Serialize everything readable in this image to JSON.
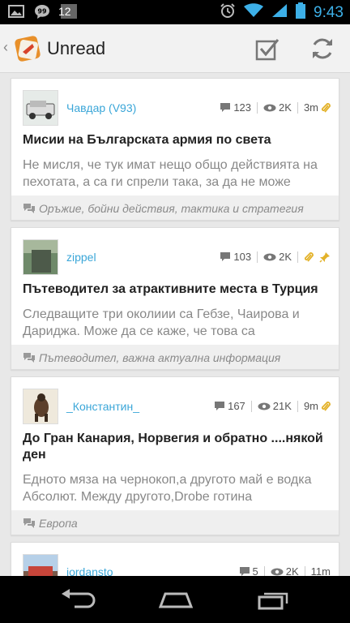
{
  "status_bar": {
    "time": "9:43",
    "notification_badge": "12",
    "icons": [
      "gallery-icon",
      "talk-icon",
      "notification-count-icon",
      "alarm-icon",
      "wifi-icon",
      "signal-icon",
      "battery-icon"
    ]
  },
  "action_bar": {
    "title": "Unread",
    "actions": [
      "mark-all-read-icon",
      "refresh-icon"
    ]
  },
  "topics": [
    {
      "author": "Чавдар (V93)",
      "replies": "123",
      "views": "2K",
      "time": "3m",
      "has_attachment": true,
      "pinned": false,
      "title": "Мисии на Българската армия по света",
      "preview": "Не мисля, че тук имат нещо общо действията на пехотата, а са ги спрели така, за да не може",
      "forum": "Оръжие, бойни действия, тактика и стратегия"
    },
    {
      "author": "zippel",
      "replies": "103",
      "views": "2K",
      "time": "",
      "has_attachment": true,
      "pinned": true,
      "title": "Пътеводител за атрактивните места в Турция",
      "preview": "Следващите три околиии са Гебзе, Чаирова и Дариджа. Може да се каже, че това са",
      "forum": "Пътеводител, важна актуална информация"
    },
    {
      "author": "_Константин_",
      "replies": "167",
      "views": "21K",
      "time": "9m",
      "has_attachment": true,
      "pinned": false,
      "title": "До Гран Канария, Норвегия и обратно ....някой ден",
      "preview": "Едното мяза на чернокоп,а другото май е водка Абсолют. Между другото,Drobe готина",
      "forum": "Европа"
    },
    {
      "author": "jordansto",
      "replies": "5",
      "views": "2K",
      "time": "11m",
      "has_attachment": false,
      "pinned": false,
      "title": "",
      "preview": "",
      "forum": ""
    }
  ],
  "nav_bar": {
    "buttons": [
      "back-icon",
      "home-icon",
      "recents-icon"
    ]
  },
  "colors": {
    "accent": "#3aa6d8",
    "status_time": "#3db0e8",
    "attachment": "#e3b22a",
    "pin": "#e3b22a"
  }
}
